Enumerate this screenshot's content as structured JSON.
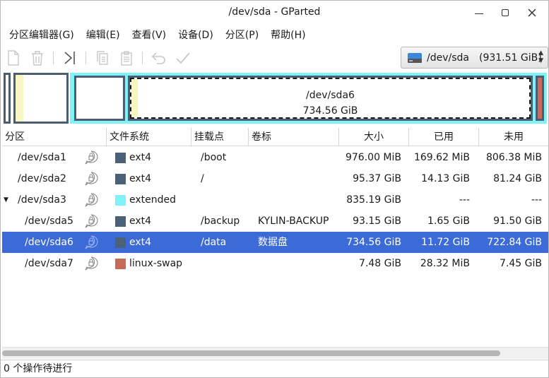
{
  "window": {
    "title": "/dev/sda - GParted"
  },
  "menubar": {
    "items": [
      "分区编辑器(G)",
      "编辑(E)",
      "查看(V)",
      "设备(D)",
      "分区(P)",
      "帮助(H)"
    ]
  },
  "toolbar": {
    "icons": [
      "new-partition-icon",
      "delete-icon",
      "resize-move-icon",
      "copy-icon",
      "paste-icon",
      "undo-icon",
      "apply-icon"
    ]
  },
  "device_selector": {
    "device": "/dev/sda",
    "size": "(931.51 GiB)"
  },
  "diskmap": {
    "selected_label": "/dev/sda6",
    "selected_size": "734.56 GiB"
  },
  "table": {
    "headers": {
      "partition": "分区",
      "filesystem": "文件系统",
      "mountpoint": "挂载点",
      "label": "卷标",
      "size": "大小",
      "used": "已用",
      "unused": "未用"
    },
    "rows": [
      {
        "partition": "/dev/sda1",
        "filesystem": "ext4",
        "color": "#4a6178",
        "mountpoint": "/boot",
        "label": "",
        "size": "976.00 MiB",
        "used": "169.62 MiB",
        "unused": "806.38 MiB",
        "locked": true
      },
      {
        "partition": "/dev/sda2",
        "filesystem": "ext4",
        "color": "#4a6178",
        "mountpoint": "/",
        "label": "",
        "size": "95.37 GiB",
        "used": "14.13 GiB",
        "unused": "81.24 GiB",
        "locked": true
      },
      {
        "partition": "/dev/sda3",
        "filesystem": "extended",
        "color": "#7ff3f8",
        "mountpoint": "",
        "label": "",
        "size": "835.19 GiB",
        "used": "---",
        "unused": "---",
        "locked": true
      },
      {
        "partition": "/dev/sda5",
        "filesystem": "ext4",
        "color": "#4a6178",
        "mountpoint": "/backup",
        "label": "KYLIN-BACKUP",
        "size": "93.15 GiB",
        "used": "1.65 GiB",
        "unused": "91.50 GiB",
        "locked": false
      },
      {
        "partition": "/dev/sda6",
        "filesystem": "ext4",
        "color": "#4a6178",
        "mountpoint": "/data",
        "label": "数据盘",
        "size": "734.56 GiB",
        "used": "11.72 GiB",
        "unused": "722.84 GiB",
        "locked": true
      },
      {
        "partition": "/dev/sda7",
        "filesystem": "linux-swap",
        "color": "#c86a5a",
        "mountpoint": "",
        "label": "",
        "size": "7.48 GiB",
        "used": "28.32 MiB",
        "unused": "7.45 GiB",
        "locked": true
      }
    ]
  },
  "status": {
    "text": "0 个操作待进行"
  }
}
